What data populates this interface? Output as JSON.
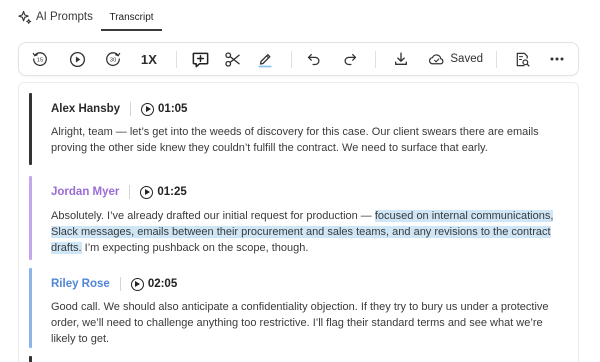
{
  "tabs": {
    "ai_prompts": "AI Prompts",
    "transcript": "Transcript"
  },
  "toolbar": {
    "speed": "1X",
    "saved": "Saved",
    "rewind_seconds": "15",
    "forward_seconds": "30"
  },
  "transcript": [
    {
      "speaker": "Alex Hansby",
      "color": "#333333",
      "time": "01:05",
      "text": "Alright, team — let’s get into the weeds of discovery for this case. Our client swears there are emails proving the other side knew they couldn’t fulfill the contract. We need to surface that early."
    },
    {
      "speaker": "Jordan Myer",
      "color": "#9b6cd8",
      "time": "01:25",
      "text_before": "Absolutely. I’ve already drafted our initial request for production — ",
      "text_highlight": "focused on internal communications, Slack messages, emails between their procurement and sales teams, and any revisions to the contract drafts.",
      "text_after": " I’m expecting pushback on the scope, though."
    },
    {
      "speaker": "Riley Rose",
      "color": "#4f86d6",
      "time": "02:05",
      "text": "Good call. We should also anticipate a confidentiality objection. If they try to bury us under a protective order, we’ll need to challenge anything too restrictive. I’ll flag their standard terms and see what we’re likely to get."
    }
  ]
}
